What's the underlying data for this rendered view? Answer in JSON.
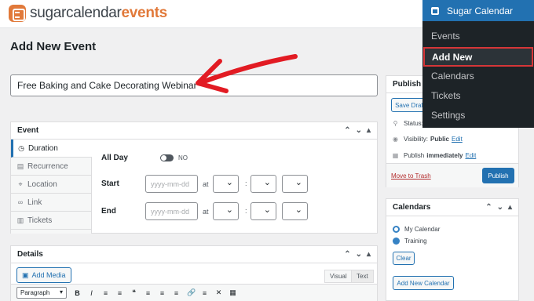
{
  "brand": {
    "sugar": "sugarcalendar",
    "events": "events"
  },
  "page_title": "Add New Event",
  "title_input": {
    "value": "Free Baking and Cake Decorating Webinar"
  },
  "event_box": {
    "title": "Event",
    "tabs": [
      {
        "label": "Duration",
        "icon": "clock-icon"
      },
      {
        "label": "Recurrence",
        "icon": "recurrence-icon"
      },
      {
        "label": "Location",
        "icon": "pin-icon"
      },
      {
        "label": "Link",
        "icon": "link-icon"
      },
      {
        "label": "Tickets",
        "icon": "ticket-icon"
      }
    ],
    "all_day_label": "All Day",
    "all_day_value": "NO",
    "start_label": "Start",
    "end_label": "End",
    "date_placeholder": "yyyy-mm-dd",
    "at_label": "at",
    "colon": ":"
  },
  "details_box": {
    "title": "Details",
    "add_media": "Add Media",
    "visual_tab": "Visual",
    "text_tab": "Text",
    "paragraph": "Paragraph",
    "toolbar": [
      "B",
      "I",
      "≡",
      "≡",
      "❝",
      "≡",
      "≡",
      "≡",
      "🔗",
      "≡",
      "✕",
      "▦"
    ]
  },
  "publish_box": {
    "title": "Publish",
    "save_draft": "Save Draft",
    "status_label": "Status:",
    "visibility_label": "Visibility:",
    "visibility_value": "Public",
    "publish_label": "Publish",
    "publish_value": "immediately",
    "edit": "Edit",
    "move_to_trash": "Move to Trash",
    "publish_button": "Publish"
  },
  "calendars_box": {
    "title": "Calendars",
    "items": [
      "My Calendar",
      "Training"
    ],
    "clear": "Clear",
    "add_new": "Add New Calendar"
  },
  "admin_menu": {
    "title": "Sugar Calendar",
    "items": [
      "Events",
      "Add New",
      "Calendars",
      "Tickets",
      "Settings"
    ]
  },
  "colors": {
    "accent": "#2271b1",
    "brand_orange": "#e1793a",
    "arrow_red": "#e21b23",
    "highlight_red": "#d63638"
  }
}
